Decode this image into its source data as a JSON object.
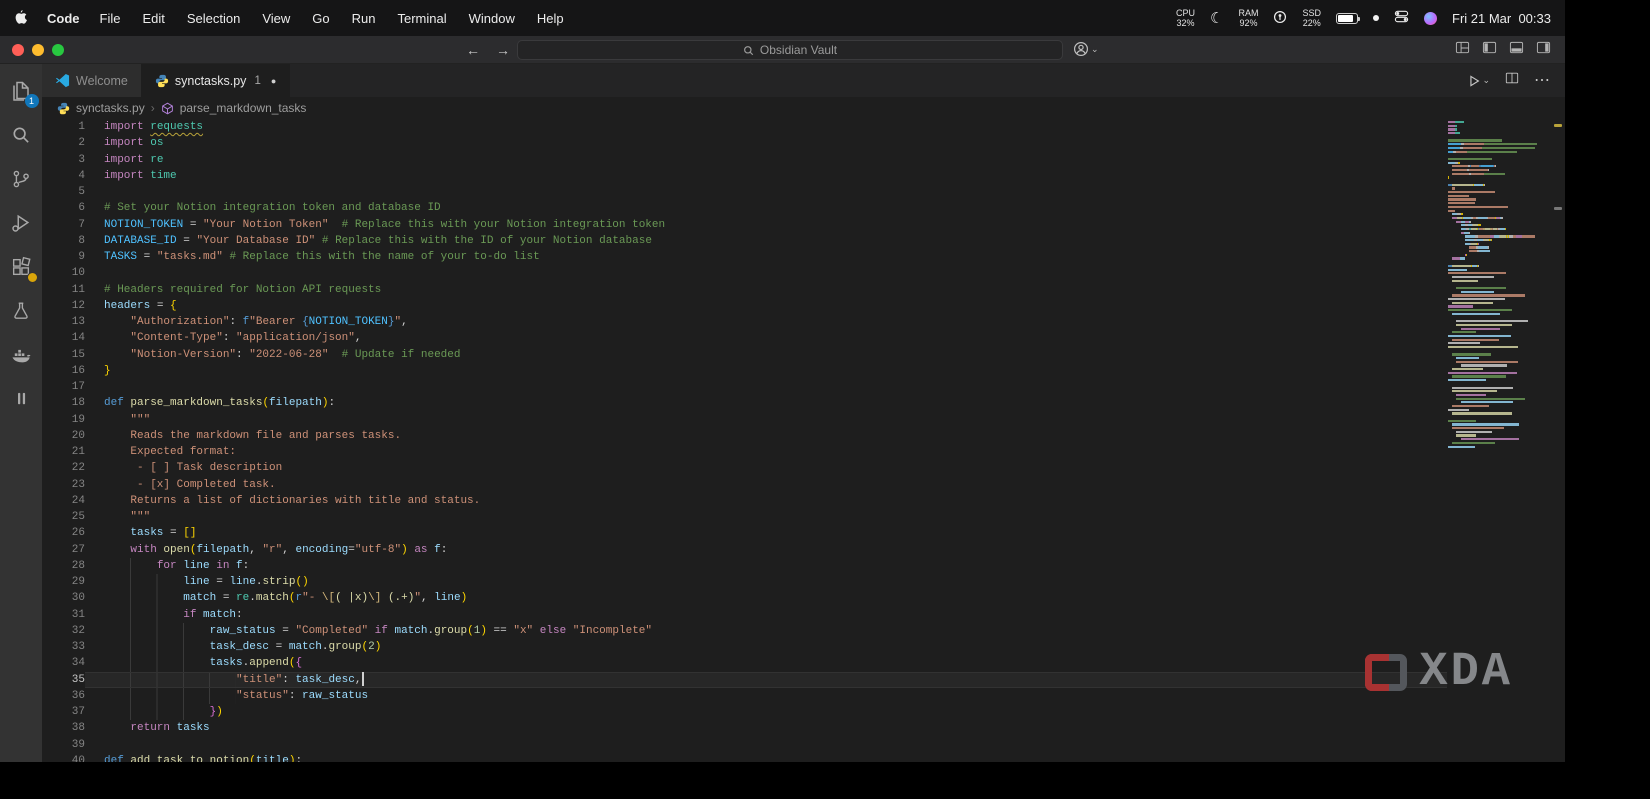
{
  "menubar": {
    "app_name": "Code",
    "items": [
      "File",
      "Edit",
      "Selection",
      "View",
      "Go",
      "Run",
      "Terminal",
      "Window",
      "Help"
    ],
    "status": {
      "cpu_label": "CPU",
      "cpu_value": "32%",
      "ram_label": "RAM",
      "ram_value": "92%",
      "ssd_label": "SSD",
      "ssd_value": "22%",
      "clock": "Fri 21 Mar  00:33"
    }
  },
  "titlebar": {
    "search_text": "Obsidian Vault"
  },
  "activitybar": {
    "items": [
      {
        "name": "explorer",
        "badge": "1"
      },
      {
        "name": "search"
      },
      {
        "name": "source-control"
      },
      {
        "name": "run-debug"
      },
      {
        "name": "extensions",
        "dot_badge": true
      },
      {
        "name": "testing"
      },
      {
        "name": "docker"
      },
      {
        "name": "pause"
      }
    ]
  },
  "tabs": [
    {
      "icon": "vscode",
      "label": "Welcome",
      "active": false
    },
    {
      "icon": "python",
      "label": "synctasks.py",
      "badge": "1",
      "modified": true,
      "active": true
    }
  ],
  "breadcrumbs": {
    "file": "synctasks.py",
    "symbol": "parse_markdown_tasks"
  },
  "editor": {
    "current_line": 35,
    "lines": [
      {
        "t": [
          [
            "import ",
            "kw"
          ],
          [
            "requests",
            "mod warn"
          ]
        ]
      },
      {
        "t": [
          [
            "import ",
            "kw"
          ],
          [
            "os",
            "mod"
          ]
        ]
      },
      {
        "t": [
          [
            "import ",
            "kw"
          ],
          [
            "re",
            "mod"
          ]
        ]
      },
      {
        "t": [
          [
            "import ",
            "kw"
          ],
          [
            "time",
            "mod"
          ]
        ]
      },
      {
        "t": []
      },
      {
        "t": [
          [
            "# Set your Notion integration token and database ID",
            "com"
          ]
        ]
      },
      {
        "t": [
          [
            "NOTION_TOKEN",
            "const"
          ],
          [
            " = ",
            "pln"
          ],
          [
            "\"Your Notion Token\"",
            "str"
          ],
          [
            "  # Replace this with your Notion integration token",
            "com"
          ]
        ]
      },
      {
        "t": [
          [
            "DATABASE_ID",
            "const"
          ],
          [
            " = ",
            "pln"
          ],
          [
            "\"Your Database ID\"",
            "str"
          ],
          [
            " # Replace this with the ID of your Notion database",
            "com"
          ]
        ]
      },
      {
        "t": [
          [
            "TASKS",
            "const"
          ],
          [
            " = ",
            "pln"
          ],
          [
            "\"tasks.md\"",
            "str"
          ],
          [
            " # Replace this with the name of your to-do list",
            "com"
          ]
        ]
      },
      {
        "t": []
      },
      {
        "t": [
          [
            "# Headers required for Notion API requests",
            "com"
          ]
        ]
      },
      {
        "t": [
          [
            "headers",
            "var"
          ],
          [
            " = ",
            "pln"
          ],
          [
            "{",
            "b1"
          ]
        ]
      },
      {
        "t": [
          [
            "    ",
            "ind"
          ],
          [
            "\"Authorization\"",
            "str"
          ],
          [
            ": ",
            "pln"
          ],
          [
            "f",
            "def"
          ],
          [
            "\"Bearer ",
            "str"
          ],
          [
            "{",
            "def"
          ],
          [
            "NOTION_TOKEN",
            "const"
          ],
          [
            "}",
            "def"
          ],
          [
            "\"",
            "str"
          ],
          [
            ",",
            "pln"
          ]
        ]
      },
      {
        "t": [
          [
            "    ",
            "ind"
          ],
          [
            "\"Content-Type\"",
            "str"
          ],
          [
            ": ",
            "pln"
          ],
          [
            "\"application/json\"",
            "str"
          ],
          [
            ",",
            "pln"
          ]
        ]
      },
      {
        "t": [
          [
            "    ",
            "ind"
          ],
          [
            "\"Notion-Version\"",
            "str"
          ],
          [
            ": ",
            "pln"
          ],
          [
            "\"2022-06-28\"",
            "str"
          ],
          [
            "  # Update if needed",
            "com"
          ]
        ]
      },
      {
        "t": [
          [
            "}",
            "b1"
          ]
        ]
      },
      {
        "t": []
      },
      {
        "t": [
          [
            "def ",
            "def"
          ],
          [
            "parse_markdown_tasks",
            "fn"
          ],
          [
            "(",
            "b1"
          ],
          [
            "filepath",
            "var"
          ],
          [
            ")",
            "b1"
          ],
          [
            ":",
            "pln"
          ]
        ]
      },
      {
        "t": [
          [
            "    ",
            "ind"
          ],
          [
            "\"\"\"",
            "str"
          ]
        ]
      },
      {
        "t": [
          [
            "    Reads the markdown file and parses tasks.",
            "str"
          ]
        ]
      },
      {
        "t": [
          [
            "    Expected format:",
            "str"
          ]
        ]
      },
      {
        "t": [
          [
            "     - [ ] Task description",
            "str"
          ]
        ]
      },
      {
        "t": [
          [
            "     - [x] Completed task.",
            "str"
          ]
        ]
      },
      {
        "t": [
          [
            "    Returns a list of dictionaries with title and status.",
            "str"
          ]
        ]
      },
      {
        "t": [
          [
            "    \"\"\"",
            "str"
          ]
        ]
      },
      {
        "t": [
          [
            "    ",
            "ind"
          ],
          [
            "tasks",
            "var"
          ],
          [
            " = ",
            "pln"
          ],
          [
            "[]",
            "b1"
          ]
        ]
      },
      {
        "t": [
          [
            "    ",
            "ind"
          ],
          [
            "with ",
            "kw"
          ],
          [
            "open",
            "fn"
          ],
          [
            "(",
            "b1"
          ],
          [
            "filepath",
            "var"
          ],
          [
            ", ",
            "pln"
          ],
          [
            "\"r\"",
            "str"
          ],
          [
            ", ",
            "pln"
          ],
          [
            "encoding",
            "var"
          ],
          [
            "=",
            "pln"
          ],
          [
            "\"utf-8\"",
            "str"
          ],
          [
            ")",
            "b1"
          ],
          [
            " as ",
            "kw"
          ],
          [
            "f",
            "var"
          ],
          [
            ":",
            "pln"
          ]
        ]
      },
      {
        "t": [
          [
            "        ",
            "ind"
          ],
          [
            "for ",
            "kw"
          ],
          [
            "line",
            "var"
          ],
          [
            " in ",
            "kw"
          ],
          [
            "f",
            "var"
          ],
          [
            ":",
            "pln"
          ]
        ]
      },
      {
        "t": [
          [
            "            ",
            "ind"
          ],
          [
            "line",
            "var"
          ],
          [
            " = ",
            "pln"
          ],
          [
            "line",
            "var"
          ],
          [
            ".",
            "pln"
          ],
          [
            "strip",
            "fn"
          ],
          [
            "()",
            "b1"
          ]
        ]
      },
      {
        "t": [
          [
            "            ",
            "ind"
          ],
          [
            "match",
            "var"
          ],
          [
            " = ",
            "pln"
          ],
          [
            "re",
            "mod"
          ],
          [
            ".",
            "pln"
          ],
          [
            "match",
            "fn"
          ],
          [
            "(",
            "b1"
          ],
          [
            "r",
            "def"
          ],
          [
            "\"- ",
            "str"
          ],
          [
            "\\[",
            "esc"
          ],
          [
            "( |x)",
            "rgx"
          ],
          [
            "\\]",
            "esc"
          ],
          [
            " ",
            "str"
          ],
          [
            "(.+)",
            "rgx"
          ],
          [
            "\"",
            "str"
          ],
          [
            ", ",
            "pln"
          ],
          [
            "line",
            "var"
          ],
          [
            ")",
            "b1"
          ]
        ]
      },
      {
        "t": [
          [
            "            ",
            "ind"
          ],
          [
            "if ",
            "kw"
          ],
          [
            "match",
            "var"
          ],
          [
            ":",
            "pln"
          ]
        ]
      },
      {
        "t": [
          [
            "                ",
            "ind"
          ],
          [
            "raw_status",
            "var"
          ],
          [
            " = ",
            "pln"
          ],
          [
            "\"Completed\"",
            "str"
          ],
          [
            " if ",
            "kw"
          ],
          [
            "match",
            "var"
          ],
          [
            ".",
            "pln"
          ],
          [
            "group",
            "fn"
          ],
          [
            "(",
            "b1"
          ],
          [
            "1",
            "num"
          ],
          [
            ")",
            "b1"
          ],
          [
            " == ",
            "pln"
          ],
          [
            "\"x\"",
            "str"
          ],
          [
            " else ",
            "kw"
          ],
          [
            "\"Incomplete\"",
            "str"
          ]
        ]
      },
      {
        "t": [
          [
            "                ",
            "ind"
          ],
          [
            "task_desc",
            "var"
          ],
          [
            " = ",
            "pln"
          ],
          [
            "match",
            "var"
          ],
          [
            ".",
            "pln"
          ],
          [
            "group",
            "fn"
          ],
          [
            "(",
            "b1"
          ],
          [
            "2",
            "num"
          ],
          [
            ")",
            "b1"
          ]
        ]
      },
      {
        "t": [
          [
            "                ",
            "ind"
          ],
          [
            "tasks",
            "var"
          ],
          [
            ".",
            "pln"
          ],
          [
            "append",
            "fn"
          ],
          [
            "(",
            "b1"
          ],
          [
            "{",
            "b2"
          ]
        ]
      },
      {
        "t": [
          [
            "                    ",
            "ind"
          ],
          [
            "\"title\"",
            "str"
          ],
          [
            ": ",
            "pln"
          ],
          [
            "task_desc",
            "var"
          ],
          [
            ",",
            "pln"
          ]
        ],
        "cursor": true
      },
      {
        "t": [
          [
            "                    ",
            "ind"
          ],
          [
            "\"status\"",
            "str"
          ],
          [
            ": ",
            "pln"
          ],
          [
            "raw_status",
            "var"
          ]
        ]
      },
      {
        "t": [
          [
            "                ",
            "ind"
          ],
          [
            "}",
            "b2"
          ],
          [
            ")",
            "b1"
          ]
        ]
      },
      {
        "t": [
          [
            "    ",
            "ind"
          ],
          [
            "return ",
            "kw"
          ],
          [
            "tasks",
            "var"
          ]
        ]
      },
      {
        "t": []
      },
      {
        "t": [
          [
            "def ",
            "def"
          ],
          [
            "add_task_to_notion",
            "fn"
          ],
          [
            "(",
            "b1"
          ],
          [
            "title",
            "var"
          ],
          [
            ")",
            "b1"
          ],
          [
            ":",
            "pln"
          ]
        ]
      }
    ]
  },
  "watermark": {
    "text": "XDA"
  },
  "colors": {
    "tokens": {
      "kw": "#C586C0",
      "def": "#569CD6",
      "mod": "#4EC9B0",
      "const": "#4FC1FF",
      "var": "#9CDCFE",
      "str": "#CE9178",
      "com": "#6A9955",
      "fn": "#DCDCAA",
      "num": "#B5CEA8",
      "pln": "#D4D4D4",
      "esc": "#D7BA7D",
      "rgx": "#DCDCAA",
      "b1": "#FFD700",
      "b2": "#DA70D6"
    },
    "ui": {
      "close": "#ff5f57",
      "min": "#febc2e",
      "zoom": "#28c840",
      "badge": "#1177bb",
      "warnbadge": "#d9a50a",
      "xdared": "#a83232"
    }
  }
}
